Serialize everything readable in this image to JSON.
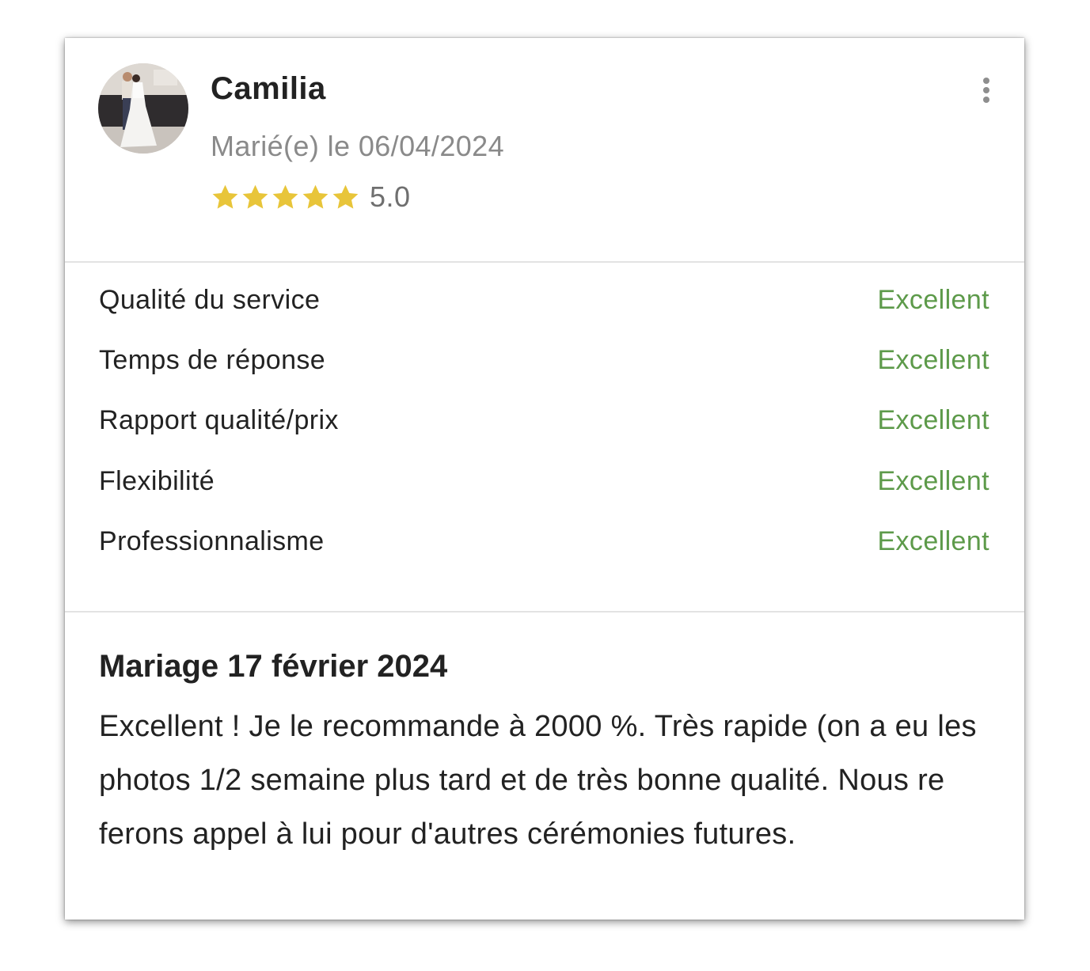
{
  "review": {
    "author": "Camilia",
    "married_date": "Marié(e) le 06/04/2024",
    "rating_value": "5.0",
    "rating_stars": 5,
    "star_color": "#e8c53a",
    "criteria": [
      {
        "label": "Qualité du service",
        "value": "Excellent"
      },
      {
        "label": "Temps de réponse",
        "value": "Excellent"
      },
      {
        "label": "Rapport qualité/prix",
        "value": "Excellent"
      },
      {
        "label": "Flexibilité",
        "value": "Excellent"
      },
      {
        "label": "Professionnalisme",
        "value": "Excellent"
      }
    ],
    "value_color": "#5d9a4a",
    "title": "Mariage 17 février 2024",
    "text": "Excellent ! Je le recommande à 2000 %. Très rapide (on a eu les photos 1/2 semaine plus tard et de très bonne qualité. Nous re ferons appel à lui pour d'autres cérémonies futures."
  },
  "icons": {
    "menu": "more-vertical-icon",
    "star": "star-icon"
  }
}
